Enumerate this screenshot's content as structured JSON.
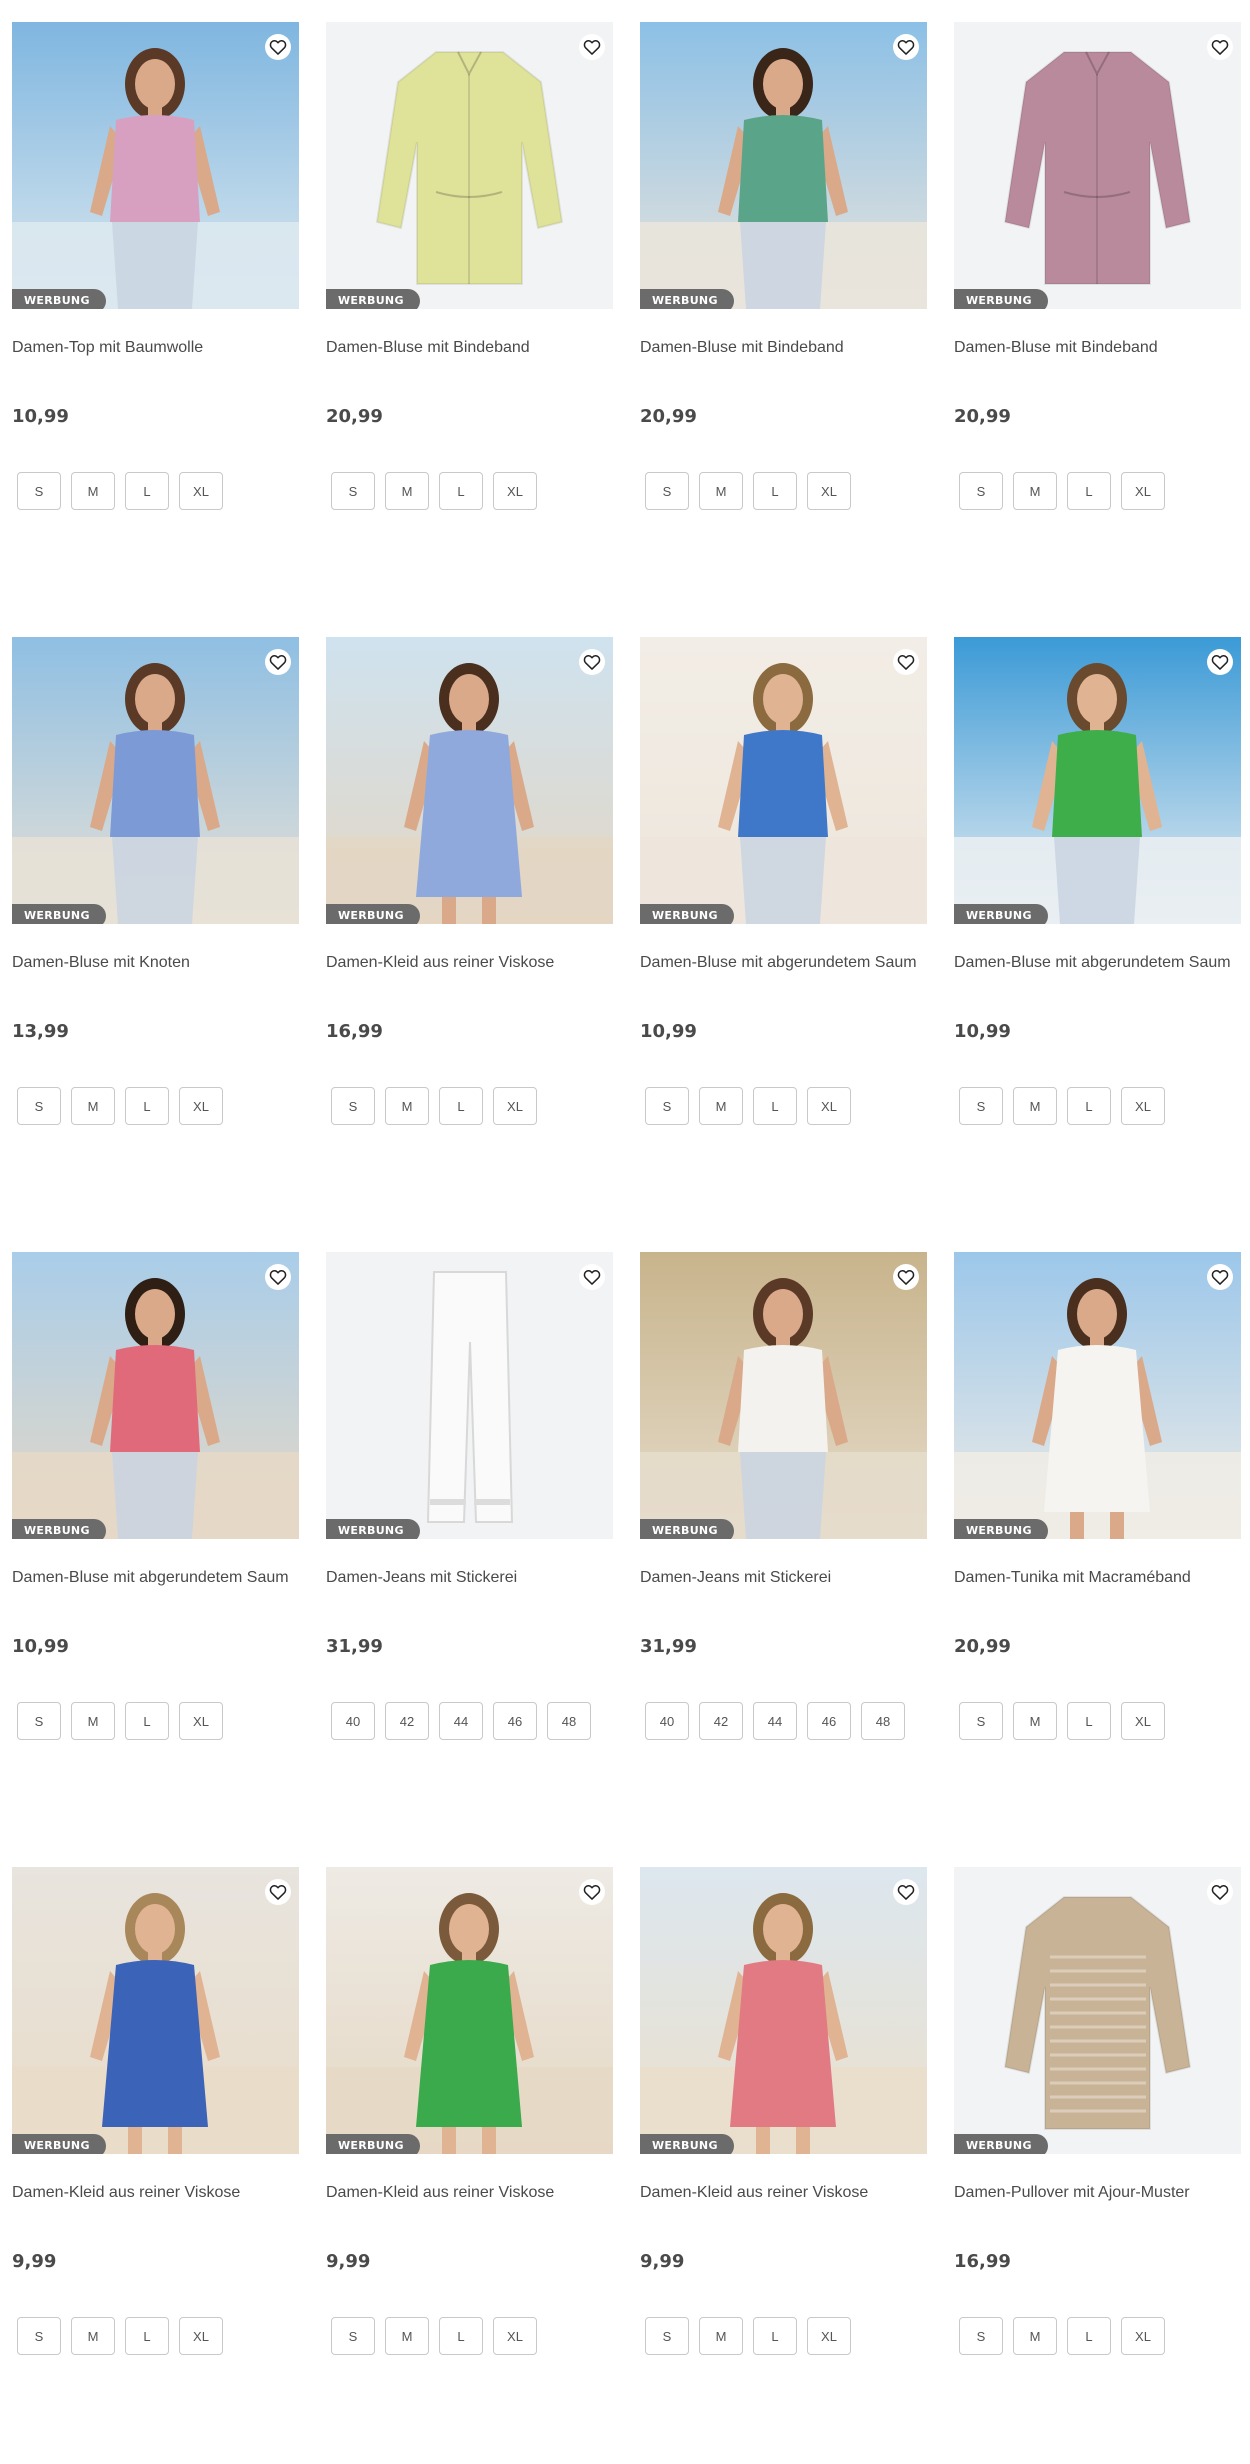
{
  "badge_label": "WERBUNG",
  "favorite_icon": "heart-outline-icon",
  "colors": {
    "badge_bg": "#6b6b6b",
    "size_border": "#c9c9c9",
    "text": "#4a4a4a"
  },
  "products": [
    {
      "title": "Damen-Top mit Baumwolle",
      "price": "10,99",
      "sizes": [
        "S",
        "M",
        "L",
        "XL"
      ],
      "image": "woman-pink-top-sea"
    },
    {
      "title": "Damen-Bluse mit Bindeband",
      "price": "20,99",
      "sizes": [
        "S",
        "M",
        "L",
        "XL"
      ],
      "image": "lime-blouse-product"
    },
    {
      "title": "Damen-Bluse mit Bindeband",
      "price": "20,99",
      "sizes": [
        "S",
        "M",
        "L",
        "XL"
      ],
      "image": "woman-green-blouse-terrace"
    },
    {
      "title": "Damen-Bluse mit Bindeband",
      "price": "20,99",
      "sizes": [
        "S",
        "M",
        "L",
        "XL"
      ],
      "image": "mauve-blouse-product"
    },
    {
      "title": "Damen-Bluse mit Knoten",
      "price": "13,99",
      "sizes": [
        "S",
        "M",
        "L",
        "XL"
      ],
      "image": "woman-blue-paisley-blouse"
    },
    {
      "title": "Damen-Kleid aus reiner Viskose",
      "price": "16,99",
      "sizes": [
        "S",
        "M",
        "L",
        "XL"
      ],
      "image": "woman-blue-dress-promenade"
    },
    {
      "title": "Damen-Bluse mit abgerundetem Saum",
      "price": "10,99",
      "sizes": [
        "S",
        "M",
        "L",
        "XL"
      ],
      "image": "woman-colorful-paisley-seated"
    },
    {
      "title": "Damen-Bluse mit abgerundetem Saum",
      "price": "10,99",
      "sizes": [
        "S",
        "M",
        "L",
        "XL"
      ],
      "image": "woman-green-paisley-blouse"
    },
    {
      "title": "Damen-Bluse mit abgerundetem Saum",
      "price": "10,99",
      "sizes": [
        "S",
        "M",
        "L",
        "XL"
      ],
      "image": "woman-pink-paisley-blouse"
    },
    {
      "title": "Damen-Jeans mit Stickerei",
      "price": "31,99",
      "sizes": [
        "40",
        "42",
        "44",
        "46",
        "48"
      ],
      "image": "white-jeans-product"
    },
    {
      "title": "Damen-Jeans mit Stickerei",
      "price": "31,99",
      "sizes": [
        "40",
        "42",
        "44",
        "46",
        "48"
      ],
      "image": "woman-light-jeans-bench"
    },
    {
      "title": "Damen-Tunika mit Macraméband",
      "price": "20,99",
      "sizes": [
        "S",
        "M",
        "L",
        "XL"
      ],
      "image": "woman-white-tunic"
    },
    {
      "title": "Damen-Kleid aus reiner Viskose",
      "price": "9,99",
      "sizes": [
        "S",
        "M",
        "L",
        "XL"
      ],
      "image": "woman-blue-paisley-dress-beach"
    },
    {
      "title": "Damen-Kleid aus reiner Viskose",
      "price": "9,99",
      "sizes": [
        "S",
        "M",
        "L",
        "XL"
      ],
      "image": "woman-green-paisley-dress"
    },
    {
      "title": "Damen-Kleid aus reiner Viskose",
      "price": "9,99",
      "sizes": [
        "S",
        "M",
        "L",
        "XL"
      ],
      "image": "woman-pink-paisley-dress-beach"
    },
    {
      "title": "Damen-Pullover mit Ajour-Muster",
      "price": "16,99",
      "sizes": [
        "S",
        "M",
        "L",
        "XL"
      ],
      "image": "beige-knit-pullover-product"
    }
  ]
}
